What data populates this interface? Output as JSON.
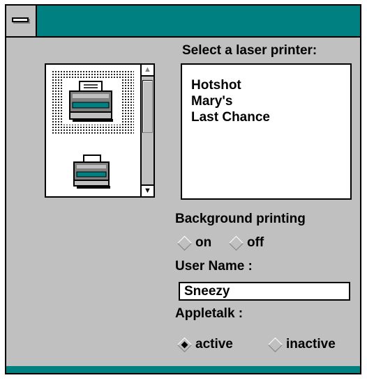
{
  "window": {
    "system_menu_icon": "system-menu-icon"
  },
  "printers": {
    "label": "Select a laser printer:",
    "items": [
      "Hotshot",
      "Mary's",
      "Last Chance"
    ]
  },
  "icons": {
    "items": [
      "printer-icon",
      "printer-icon"
    ],
    "scroll_up_icon": "scroll-up-arrow-icon",
    "scroll_down_icon": "scroll-down-arrow-icon"
  },
  "background_printing": {
    "label": "Background printing",
    "on_label": "on",
    "off_label": "off",
    "selected": null
  },
  "user_name": {
    "label": "User Name :",
    "value": "Sneezy"
  },
  "appletalk": {
    "label": "Appletalk :",
    "active_label": "active",
    "inactive_label": "inactive",
    "selected": "active"
  },
  "colors": {
    "titlebar": "#008080",
    "face": "#c0c0c0"
  }
}
